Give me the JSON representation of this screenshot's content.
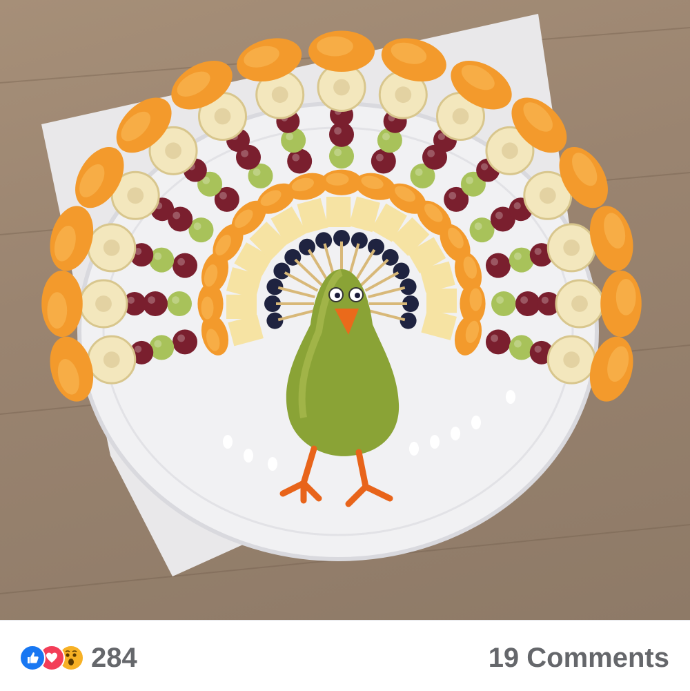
{
  "post": {
    "photo_alt": "",
    "reactions": {
      "icons": [
        "like-icon",
        "love-icon",
        "wow-icon"
      ],
      "count": "284"
    },
    "comments_label": "19 Comments"
  },
  "colors": {
    "like": "#1877f2",
    "love": "#f33e58",
    "wow": "#f7b125",
    "meta_text": "#65676b"
  }
}
